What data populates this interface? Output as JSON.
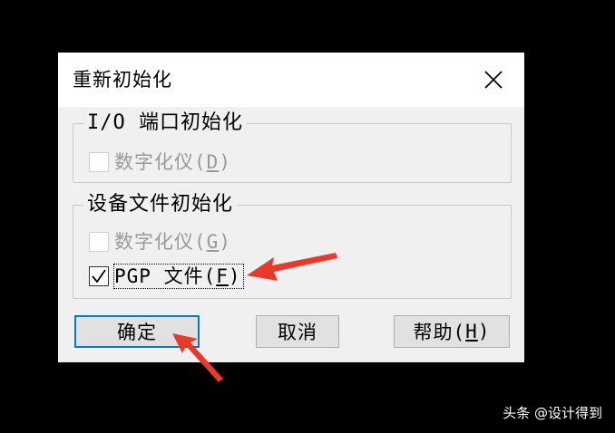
{
  "dialog": {
    "title": "重新初始化",
    "close_icon": "close-icon"
  },
  "io_group": {
    "label": "I/O 端口初始化",
    "items": [
      {
        "label_prefix": "数字化仪(",
        "hotkey": "D",
        "label_suffix": ")",
        "checked": false,
        "enabled": false
      }
    ]
  },
  "device_group": {
    "label": "设备文件初始化",
    "items": [
      {
        "label_prefix": "数字化仪(",
        "hotkey": "G",
        "label_suffix": ")",
        "checked": false,
        "enabled": false
      },
      {
        "label_prefix": "PGP 文件(",
        "hotkey": "F",
        "label_suffix": ")",
        "checked": true,
        "enabled": true
      }
    ]
  },
  "buttons": {
    "ok_label": "确定",
    "cancel_label": "取消",
    "help_prefix": "帮助(",
    "help_hotkey": "H",
    "help_suffix": ")"
  },
  "annotations": {
    "arrow_color": "#e8392a"
  },
  "watermark": "头条 @设计得到"
}
